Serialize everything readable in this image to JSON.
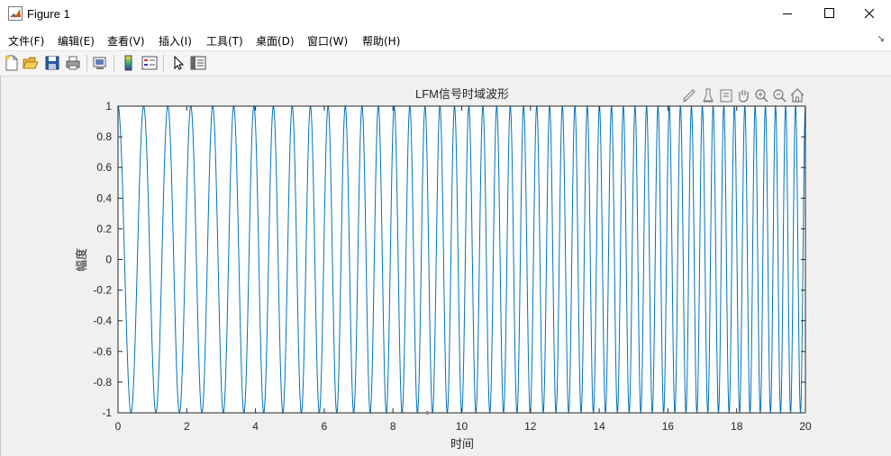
{
  "window": {
    "title": "Figure 1",
    "minimize_icon": "minimize-icon",
    "maximize_icon": "maximize-icon",
    "close_icon": "close-icon"
  },
  "menu": {
    "items": [
      {
        "label": "文件(F)"
      },
      {
        "label": "编辑(E)"
      },
      {
        "label": "查看(V)"
      },
      {
        "label": "插入(I)"
      },
      {
        "label": "工具(T)"
      },
      {
        "label": "桌面(D)"
      },
      {
        "label": "窗口(W)"
      },
      {
        "label": "帮助(H)"
      }
    ]
  },
  "toolbar": {
    "icons": [
      "new-figure-icon",
      "open-icon",
      "save-icon",
      "print-icon",
      "link-plot-icon",
      "colorbar-icon",
      "legend-icon",
      "pointer-icon",
      "property-inspector-icon"
    ]
  },
  "axes_toolbar": {
    "icons": [
      "brush-icon",
      "data-cursor-icon",
      "restore-view-icon",
      "pan-icon",
      "zoom-in-icon",
      "zoom-out-icon",
      "home-icon"
    ]
  },
  "chart_data": {
    "type": "line",
    "title": "LFM信号时域波形",
    "xlabel": "时间",
    "ylabel": "幅度",
    "xlim": [
      0,
      20
    ],
    "ylim": [
      -1,
      1
    ],
    "x_ticks": [
      "0",
      "2",
      "4",
      "6",
      "8",
      "10",
      "12",
      "14",
      "16",
      "18",
      "20"
    ],
    "y_ticks": [
      "1",
      "0.8",
      "0.6",
      "0.4",
      "0.2",
      "0",
      "-0.2",
      "-0.4",
      "-0.6",
      "-0.8",
      "-1"
    ],
    "grid": false,
    "series": [
      {
        "function": "y = cos(2π(f0·t + k·t²/2))",
        "f0": 1.3,
        "k": 0.11,
        "x_range": [
          0,
          20
        ],
        "color": "#0072bd"
      }
    ],
    "annotations": [
      {
        "type": "data-point-marker",
        "x": 9,
        "y": -1
      }
    ]
  }
}
